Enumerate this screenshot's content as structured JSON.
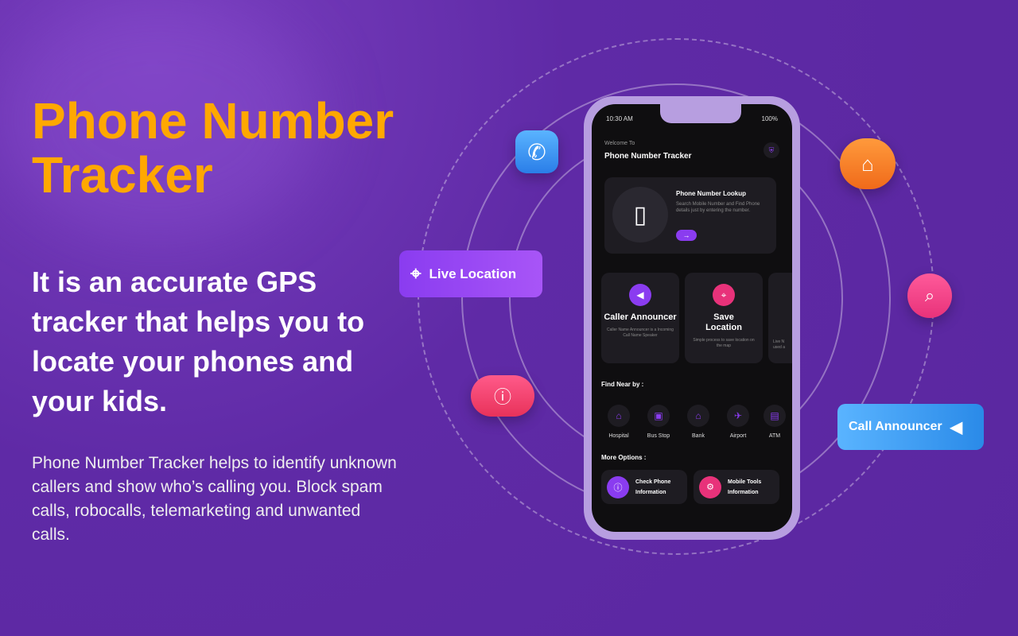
{
  "hero": {
    "title": "Phone Number Tracker",
    "subtitle": "It is an accurate GPS tracker that helps you to locate your phones and your kids.",
    "description": "Phone Number Tracker helps to identify unknown callers and show who’s calling you. Block spam calls, robocalls, telemarketing and unwanted calls."
  },
  "floating": {
    "live_location": "Live Location",
    "call_announcer": "Call Announcer"
  },
  "colors": {
    "background": "#5f2aa6",
    "title": "#ffa800",
    "accent": "#8a3cf0",
    "pink": "#e8327a"
  },
  "phone": {
    "status": {
      "time": "10:30 AM",
      "battery": "100%"
    },
    "welcome": "Welcome To",
    "app_title": "Phone Number Tracker",
    "lookup": {
      "title": "Phone Number Lookup",
      "text": "Search Mobile Number and Find Phone details just by entering the number."
    },
    "features": [
      {
        "title": "Caller Announcer",
        "text": "Caller Name Announcer is a Incoming Call Name Speaker"
      },
      {
        "title": "Save Location",
        "text": "Simple process to save location on the map"
      },
      {
        "title": "",
        "text": "Live N used a"
      }
    ],
    "near_heading": "Find Near by :",
    "near": [
      "Hospital",
      "Bus Stop",
      "Bank",
      "Airport",
      "ATM"
    ],
    "more_heading": "More Options :",
    "more": [
      "Check Phone Information",
      "Mobile Tools Information"
    ]
  }
}
